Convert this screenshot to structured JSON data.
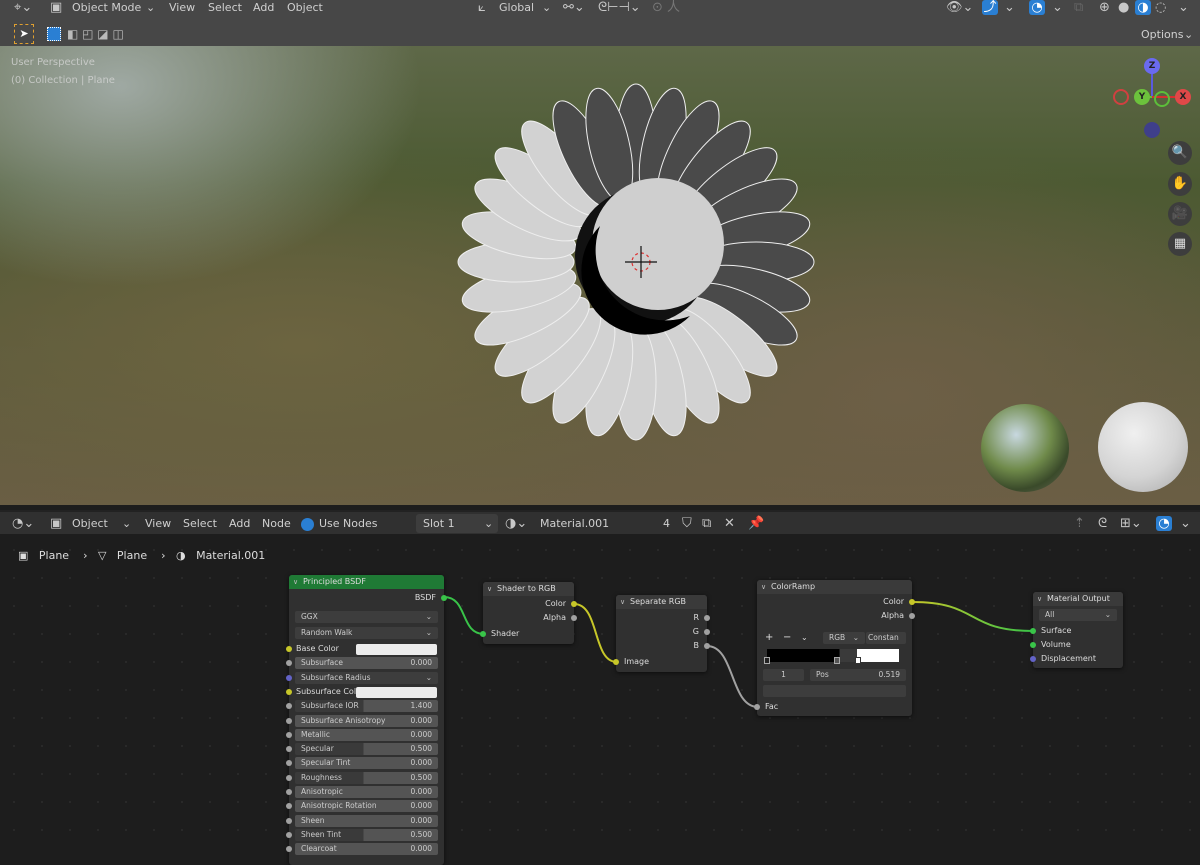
{
  "top_header": {
    "mode": "Object Mode",
    "menus": [
      "View",
      "Select",
      "Add",
      "Object"
    ],
    "transform_orientation": "Global",
    "options": "Options"
  },
  "viewport": {
    "perspective": "User Perspective",
    "collection": "(0) Collection | Plane",
    "gizmo": {
      "z": "Z",
      "y": "Y",
      "x": "X"
    }
  },
  "node_header": {
    "mode": "Object",
    "menus": [
      "View",
      "Select",
      "Add",
      "Node"
    ],
    "use_nodes": "Use Nodes",
    "slot": "Slot 1",
    "material": "Material.001",
    "users": "4"
  },
  "breadcrumb": [
    "Plane",
    "Plane",
    "Material.001"
  ],
  "colors": {
    "accent": "#2a7fd3",
    "bsdf_header": "#1f7a35",
    "shader_link": "#39c449",
    "color_link": "#c7c729"
  },
  "nodes": {
    "bsdf": {
      "title": "Principled BSDF",
      "output": "BSDF",
      "distribution": "GGX",
      "subsurface_method": "Random Walk",
      "inputs": [
        {
          "label": "Base Color",
          "type": "color"
        },
        {
          "label": "Subsurface",
          "value": "0.000"
        },
        {
          "label": "Subsurface Radius",
          "type": "menu"
        },
        {
          "label": "Subsurface Colo",
          "type": "color"
        },
        {
          "label": "Subsurface IOR",
          "value": "1.400"
        },
        {
          "label": "Subsurface Anisotropy",
          "value": "0.000"
        },
        {
          "label": "Metallic",
          "value": "0.000"
        },
        {
          "label": "Specular",
          "value": "0.500"
        },
        {
          "label": "Specular Tint",
          "value": "0.000"
        },
        {
          "label": "Roughness",
          "value": "0.500"
        },
        {
          "label": "Anisotropic",
          "value": "0.000"
        },
        {
          "label": "Anisotropic Rotation",
          "value": "0.000"
        },
        {
          "label": "Sheen",
          "value": "0.000"
        },
        {
          "label": "Sheen Tint",
          "value": "0.500"
        },
        {
          "label": "Clearcoat",
          "value": "0.000"
        }
      ]
    },
    "shader_to_rgb": {
      "title": "Shader to RGB",
      "outputs": [
        "Color",
        "Alpha"
      ],
      "input": "Shader"
    },
    "separate_rgb": {
      "title": "Separate RGB",
      "outputs": [
        "R",
        "G",
        "B"
      ],
      "input": "Image"
    },
    "color_ramp": {
      "title": "ColorRamp",
      "outputs": [
        "Color",
        "Alpha"
      ],
      "color_mode": "RGB",
      "interpolation": "Constan",
      "active_index": "1",
      "pos_label": "Pos",
      "pos": "0.519",
      "input": "Fac"
    },
    "material_output": {
      "title": "Material Output",
      "target": "All",
      "inputs": [
        "Surface",
        "Volume",
        "Displacement"
      ]
    }
  }
}
